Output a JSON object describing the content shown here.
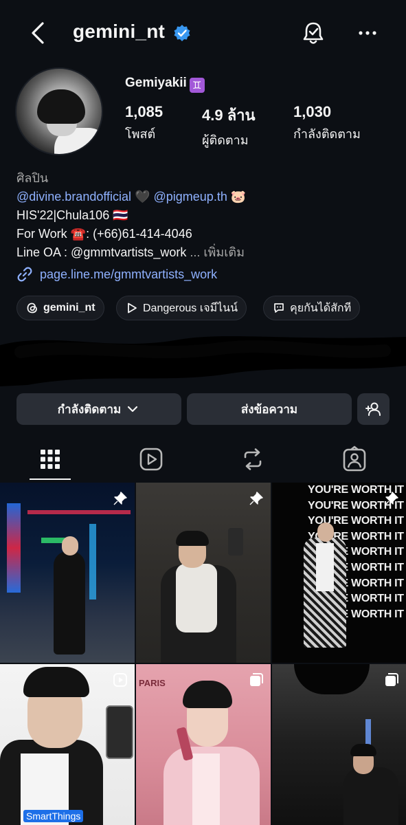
{
  "header": {
    "username": "gemini_nt",
    "icons": [
      "back-arrow-icon",
      "verified-badge-icon",
      "notification-bell-icon",
      "more-options-icon"
    ]
  },
  "profile": {
    "display_name": "Gemiyakii",
    "zodiac_emoji": "♊",
    "stats": [
      {
        "value": "1,085",
        "label": "โพสต์"
      },
      {
        "value": "4.9 ล้าน",
        "label": "ผู้ติดตาม"
      },
      {
        "value": "1,030",
        "label": "กำลังติดตาม"
      }
    ]
  },
  "bio": {
    "category": "ศิลปิน",
    "line1_mention1": "@divine.brandofficial",
    "line1_heart": "🖤",
    "line1_mention2": "@pigmeup.th",
    "line1_emoji": "🐷",
    "line2": "HIS'22|Chula106",
    "line2_flag": "🇹🇭",
    "line3_prefix": "For Work",
    "line3_phone_emoji": "☎️",
    "line3_suffix": ": (+66)61-414-4046",
    "line4": "Line OA : @gmmtvartists_work",
    "more_label": "... เพิ่มเติม",
    "link": "page.line.me/gmmtvartists_work"
  },
  "chips": [
    {
      "label": "gemini_nt",
      "icon": "threads-icon"
    },
    {
      "label": "Dangerous เจมีไนน์",
      "icon": "play-icon"
    },
    {
      "label": "คุยกันได้สักที",
      "icon": "chat-bubble-icon"
    }
  ],
  "actions": {
    "following_label": "กำลังติดตาม",
    "message_label": "ส่งข้อความ",
    "suggest_icon": "add-person-icon"
  },
  "tabs": [
    "grid-icon",
    "reels-icon",
    "reposts-icon",
    "tagged-icon"
  ],
  "posts": [
    {
      "type": "pinned",
      "overlay_text": ""
    },
    {
      "type": "pinned",
      "overlay_text": ""
    },
    {
      "type": "pinned",
      "overlay_text": "YOU'RE WORTH IT"
    },
    {
      "type": "reel",
      "overlay_text": "SmartThings"
    },
    {
      "type": "carousel",
      "overlay_text": "PARIS"
    },
    {
      "type": "carousel",
      "overlay_text": ""
    }
  ],
  "colors": {
    "background": "#0c0f14",
    "link": "#8fb1ff",
    "verified": "#3897f0",
    "button": "#2a2e36"
  }
}
